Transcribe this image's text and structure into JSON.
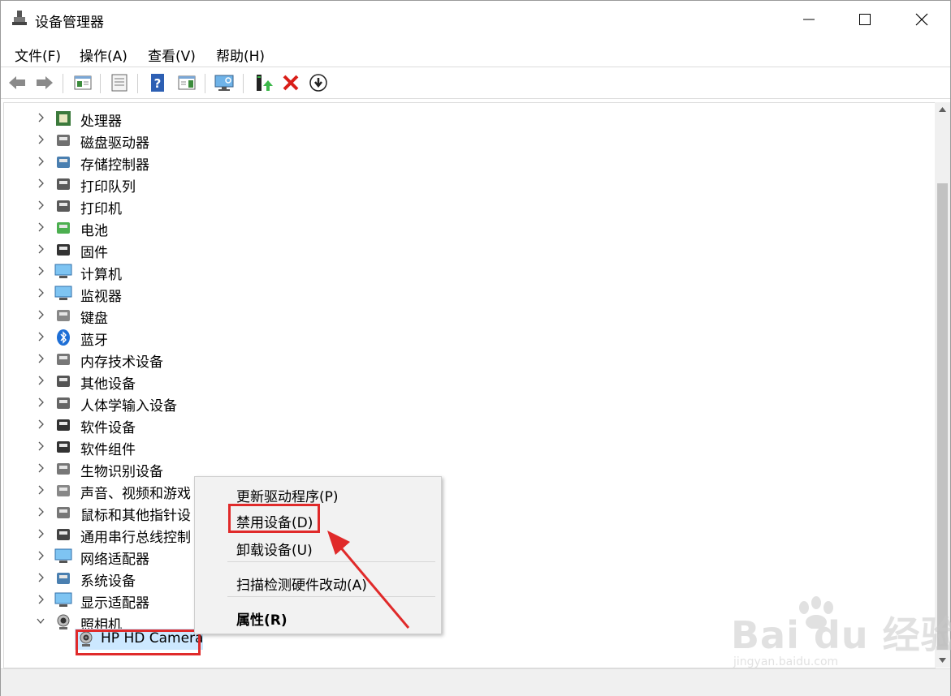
{
  "window": {
    "title": "设备管理器",
    "minimize_label": "—",
    "maximize_label": "□",
    "close_label": "✕"
  },
  "menubar": {
    "items": [
      "文件(F)",
      "操作(A)",
      "查看(V)",
      "帮助(H)"
    ]
  },
  "toolbar": {
    "icons": [
      "back-arrow-icon",
      "forward-arrow-icon",
      "show-hide-console-tree-icon",
      "properties-icon",
      "help-icon",
      "show-action-pane-icon",
      "scan-hardware-icon",
      "update-driver-icon",
      "uninstall-device-icon",
      "disable-device-icon"
    ]
  },
  "tree": {
    "categories": [
      {
        "label": "处理器",
        "icon": "processor-icon",
        "expanded": false
      },
      {
        "label": "磁盘驱动器",
        "icon": "disk-drive-icon",
        "expanded": false
      },
      {
        "label": "存储控制器",
        "icon": "storage-controller-icon",
        "expanded": false
      },
      {
        "label": "打印队列",
        "icon": "print-queue-icon",
        "expanded": false
      },
      {
        "label": "打印机",
        "icon": "printer-icon",
        "expanded": false
      },
      {
        "label": "电池",
        "icon": "battery-icon",
        "expanded": false
      },
      {
        "label": "固件",
        "icon": "firmware-icon",
        "expanded": false
      },
      {
        "label": "计算机",
        "icon": "computer-icon",
        "expanded": false
      },
      {
        "label": "监视器",
        "icon": "monitor-icon",
        "expanded": false
      },
      {
        "label": "键盘",
        "icon": "keyboard-icon",
        "expanded": false
      },
      {
        "label": "蓝牙",
        "icon": "bluetooth-icon",
        "expanded": false
      },
      {
        "label": "内存技术设备",
        "icon": "memory-device-icon",
        "expanded": false
      },
      {
        "label": "其他设备",
        "icon": "other-devices-icon",
        "expanded": false
      },
      {
        "label": "人体学输入设备",
        "icon": "hid-icon",
        "expanded": false
      },
      {
        "label": "软件设备",
        "icon": "software-device-icon",
        "expanded": false
      },
      {
        "label": "软件组件",
        "icon": "software-component-icon",
        "expanded": false
      },
      {
        "label": "生物识别设备",
        "icon": "biometric-icon",
        "expanded": false
      },
      {
        "label": "声音、视频和游戏",
        "icon": "sound-icon",
        "expanded": false
      },
      {
        "label": "鼠标和其他指针设",
        "icon": "mouse-icon",
        "expanded": false
      },
      {
        "label": "通用串行总线控制",
        "icon": "usb-icon",
        "expanded": false
      },
      {
        "label": "网络适配器",
        "icon": "network-adapter-icon",
        "expanded": false
      },
      {
        "label": "系统设备",
        "icon": "system-device-icon",
        "expanded": false
      },
      {
        "label": "显示适配器",
        "icon": "display-adapter-icon",
        "expanded": false
      },
      {
        "label": "照相机",
        "icon": "camera-icon",
        "expanded": true
      }
    ],
    "selected_child": {
      "label": "HP HD Camera",
      "icon": "webcam-icon"
    }
  },
  "context_menu": {
    "items": [
      {
        "label": "更新驱动程序(P)",
        "bold": false
      },
      {
        "label": "禁用设备(D)",
        "bold": false,
        "highlighted": true
      },
      {
        "label": "卸载设备(U)",
        "bold": false
      },
      {
        "label": "扫描检测硬件改动(A)",
        "bold": false
      },
      {
        "label": "属性(R)",
        "bold": true
      }
    ]
  },
  "watermark": {
    "text": "Bai du 经验",
    "url": "jingyan.baidu.com"
  },
  "colors": {
    "selection": "#cce8ff",
    "annotation_red": "#e02a2a",
    "menu_bg": "#f2f2f2"
  }
}
